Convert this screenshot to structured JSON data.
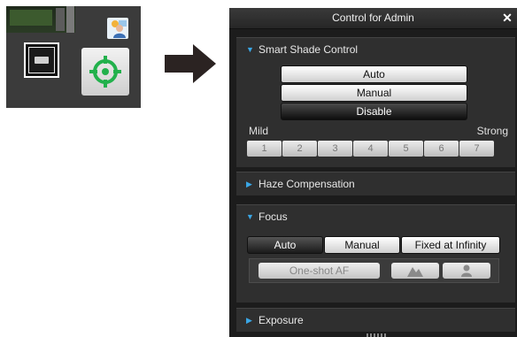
{
  "panel": {
    "title": "Control for Admin",
    "close_glyph": "✕"
  },
  "smart_shade": {
    "header": "Smart Shade Control",
    "expanded": true,
    "buttons": [
      {
        "label": "Auto",
        "selected": false
      },
      {
        "label": "Manual",
        "selected": false
      },
      {
        "label": "Disable",
        "selected": true
      }
    ],
    "mild_label": "Mild",
    "strong_label": "Strong",
    "levels": [
      "1",
      "2",
      "3",
      "4",
      "5",
      "6",
      "7"
    ]
  },
  "haze": {
    "header": "Haze Compensation",
    "expanded": false
  },
  "focus": {
    "header": "Focus",
    "expanded": true,
    "modes": [
      {
        "label": "Auto",
        "selected": true
      },
      {
        "label": "Manual",
        "selected": false
      },
      {
        "label": "Fixed at Infinity",
        "selected": false
      }
    ],
    "one_shot_label": "One-shot AF",
    "far_icon": "mountain-icon",
    "near_icon": "person-icon"
  },
  "exposure": {
    "header": "Exposure",
    "expanded": false
  },
  "colors": {
    "accent": "#3aa7e6",
    "panel_bg": "#1c1c1c",
    "section_bg": "#2f2f2f"
  }
}
